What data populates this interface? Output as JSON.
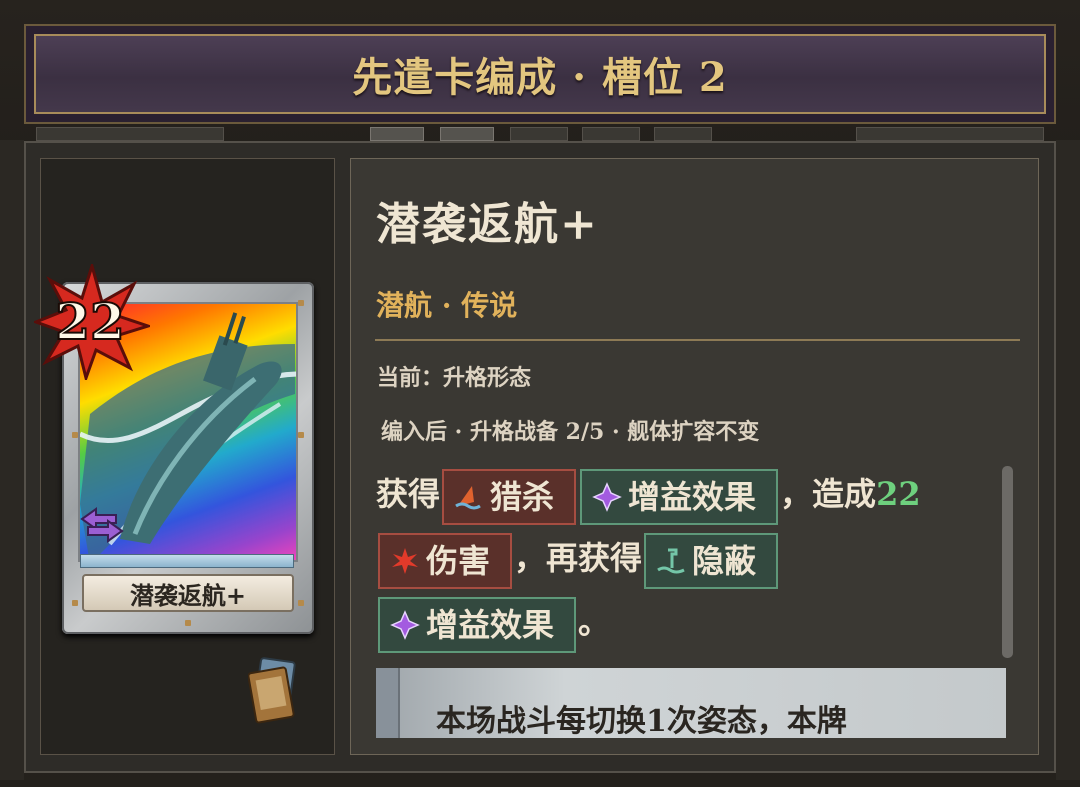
{
  "header": {
    "title": "先遣卡编成 · 槽位 2"
  },
  "card": {
    "cost": "22",
    "name": "潜袭返航+",
    "art_icon": "submarine-art",
    "cost_icon": "red-star-badge"
  },
  "detail": {
    "title": "潜袭返航+",
    "subtitle": "潜航 · 传说",
    "state": "当前：升格形态",
    "equip": "编入后 · 升格战备 2/5 · 舰体扩容不变",
    "desc": {
      "part1": "获得",
      "kw_hunt": "猎杀",
      "kw_buff1": "增益效果",
      "part2": "，造成",
      "damage_value": "22",
      "kw_damage": "伤害",
      "part3": "，再获得",
      "kw_stealth": "隐蔽",
      "kw_buff2": "增益效果",
      "part4": "。"
    },
    "effect_text": "本场战斗每切换1次姿态，本牌"
  },
  "colors": {
    "title_gold": "#e3c67f",
    "subtitle_gold": "#e1b25b",
    "damage_green": "#6ed07e",
    "keyword_red": "#a64d41",
    "keyword_green": "#5e9879"
  }
}
